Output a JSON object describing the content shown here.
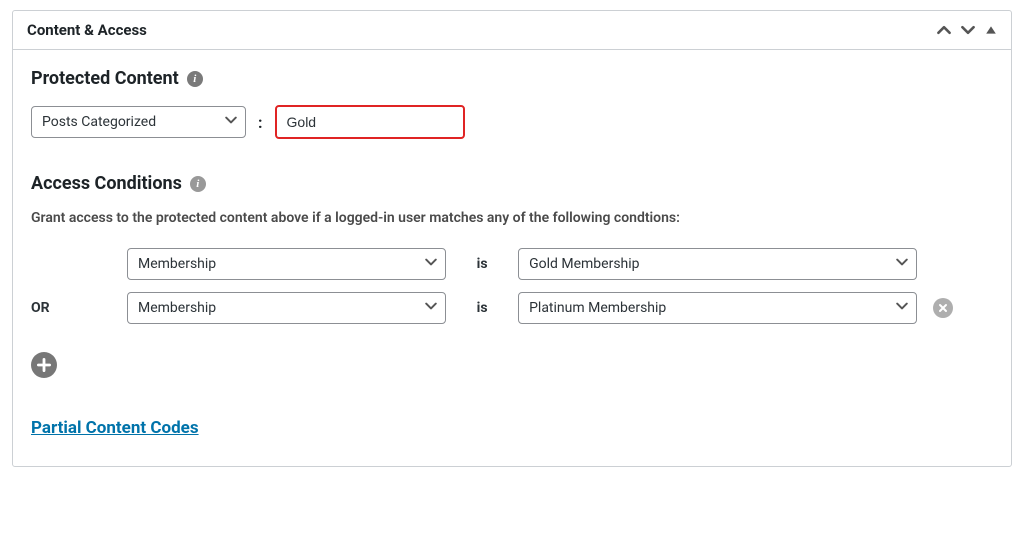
{
  "panel": {
    "title": "Content & Access"
  },
  "protected": {
    "heading": "Protected Content",
    "type_select": "Posts Categorized",
    "separator": ":",
    "value": "Gold"
  },
  "access": {
    "heading": "Access Conditions",
    "description": "Grant access to the protected content above if a logged-in user matches any of the following condtions:",
    "or_label": "OR",
    "verb": "is",
    "conditions": [
      {
        "key_select": "Membership",
        "value_select": "Gold Membership",
        "removable": false
      },
      {
        "key_select": "Membership",
        "value_select": "Platinum Membership",
        "removable": true
      }
    ]
  },
  "link": {
    "label": "Partial Content Codes"
  }
}
